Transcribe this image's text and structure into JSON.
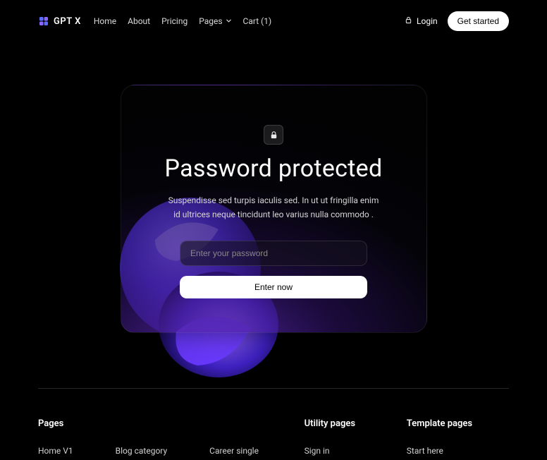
{
  "brand": {
    "name": "GPT X"
  },
  "nav": {
    "home": "Home",
    "about": "About",
    "pricing": "Pricing",
    "pages": "Pages",
    "cart": "Cart (1)"
  },
  "auth": {
    "login": "Login",
    "get_started": "Get started"
  },
  "card": {
    "title": "Password protected",
    "desc": "Suspendisse sed turpis iaculis sed. In ut ut fringilla enim id ultrices neque tincidunt leo varius nulla commodo .",
    "placeholder": "Enter your password",
    "submit": "Enter now"
  },
  "footer": {
    "pages_heading": "Pages",
    "utility_heading": "Utility pages",
    "template_heading": "Template pages",
    "pages_links": {
      "a": "Home V1",
      "b": "Blog category",
      "c": "Career single"
    },
    "utility_link": "Sign in",
    "template_link": "Start here"
  }
}
